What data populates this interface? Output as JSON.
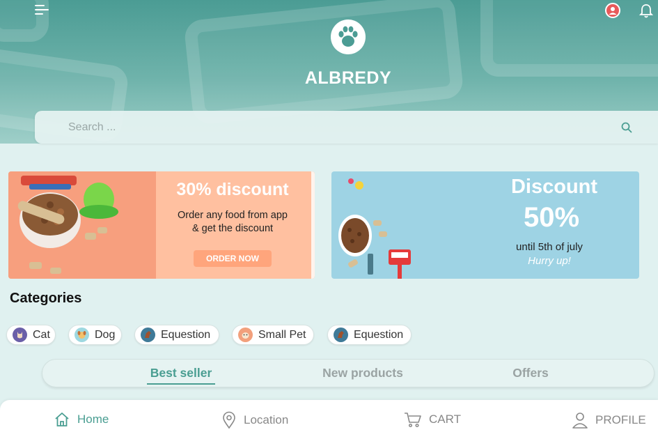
{
  "app": {
    "brand": "ALBREDY"
  },
  "header": {
    "menu_icon": "hamburger-menu-icon",
    "profile_icon": "user-avatar-icon",
    "notification_icon": "bell-icon",
    "logo_icon": "paw-icon"
  },
  "search": {
    "placeholder": "Search ...",
    "value": "",
    "icon": "search-icon"
  },
  "banners": [
    {
      "headline": "30% discount",
      "line1": "Order any food from app",
      "line2": "& get the discount",
      "button": "ORDER NOW",
      "accent": "#ffb08e"
    },
    {
      "headline": "Discount",
      "percent": "50%",
      "line1": "until 5th of july",
      "line2": "Hurry up!",
      "accent": "#9ed3e4"
    }
  ],
  "categories": {
    "title": "Categories",
    "items": [
      {
        "label": "Cat",
        "icon": "cat-icon"
      },
      {
        "label": "Dog",
        "icon": "dog-icon"
      },
      {
        "label": "Equestion",
        "icon": "horse-icon"
      },
      {
        "label": "Small Pet",
        "icon": "hamster-icon"
      },
      {
        "label": "Equestion",
        "icon": "horse-icon"
      }
    ]
  },
  "tabs": [
    {
      "label": "Best seller",
      "active": true
    },
    {
      "label": "New products",
      "active": false
    },
    {
      "label": "Offers",
      "active": false
    }
  ],
  "bottom_nav": [
    {
      "label": "Home",
      "icon": "home-icon",
      "active": true
    },
    {
      "label": "Location",
      "icon": "location-pin-icon",
      "active": false
    },
    {
      "label": "CART",
      "icon": "cart-icon",
      "active": false
    },
    {
      "label": "PROFILE",
      "icon": "profile-icon",
      "active": false
    }
  ],
  "colors": {
    "primary": "#4a9e92",
    "background": "#e0f1f0",
    "inactive": "#888888"
  }
}
